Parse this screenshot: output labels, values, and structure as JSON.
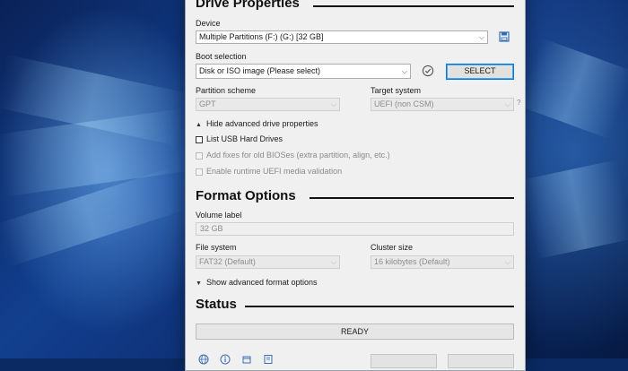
{
  "drive_properties": {
    "title": "Drive Properties",
    "device_label": "Device",
    "device_value": "Multiple Partitions (F:) (G:) [32 GB]",
    "boot_selection_label": "Boot selection",
    "boot_selection_value": "Disk or ISO image (Please select)",
    "select_button": "SELECT",
    "partition_scheme_label": "Partition scheme",
    "partition_scheme_value": "GPT",
    "target_system_label": "Target system",
    "target_system_value": "UEFI (non CSM)",
    "help_mark": "?",
    "advanced_toggle": "Hide advanced drive properties",
    "list_usb_label": "List USB Hard Drives",
    "add_fixes_label": "Add fixes for old BIOSes (extra partition, align, etc.)",
    "uefi_validation_label": "Enable runtime UEFI media validation"
  },
  "format_options": {
    "title": "Format Options",
    "volume_label_label": "Volume label",
    "volume_label_value": "32 GB",
    "file_system_label": "File system",
    "file_system_value": "FAT32 (Default)",
    "cluster_size_label": "Cluster size",
    "cluster_size_value": "16 kilobytes (Default)",
    "advanced_toggle": "Show advanced format options"
  },
  "status": {
    "title": "Status",
    "value": "READY"
  },
  "icons": {
    "save": "save-icon",
    "check": "check-circle-icon",
    "globe": "globe-icon",
    "info": "info-icon",
    "settings": "settings-icon",
    "log": "log-icon"
  },
  "colors": {
    "accent": "#0078d7",
    "window_bg": "#f0f0f0"
  }
}
